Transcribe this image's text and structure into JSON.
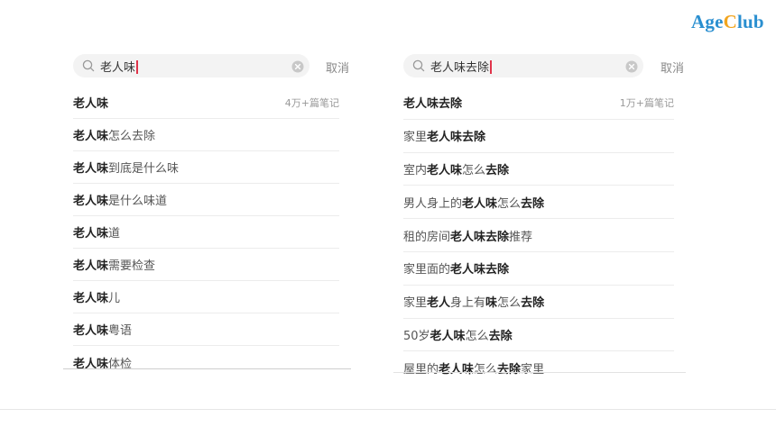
{
  "logo": {
    "part1": "Age",
    "part2": "C",
    "part3": "lub"
  },
  "left": {
    "query": "老人味",
    "cancel": "取消",
    "suggestions": [
      {
        "segments": [
          {
            "t": "老人味",
            "b": true
          }
        ],
        "count": "4万+篇笔记"
      },
      {
        "segments": [
          {
            "t": "老人味",
            "b": true
          },
          {
            "t": "怎么去除",
            "b": false
          }
        ]
      },
      {
        "segments": [
          {
            "t": "老人味",
            "b": true
          },
          {
            "t": "到底是什么味",
            "b": false
          }
        ]
      },
      {
        "segments": [
          {
            "t": "老人味",
            "b": true
          },
          {
            "t": "是什么味道",
            "b": false
          }
        ]
      },
      {
        "segments": [
          {
            "t": "老人味",
            "b": true
          },
          {
            "t": "道",
            "b": false
          }
        ]
      },
      {
        "segments": [
          {
            "t": "老人味",
            "b": true
          },
          {
            "t": "需要检查",
            "b": false
          }
        ]
      },
      {
        "segments": [
          {
            "t": "老人味",
            "b": true
          },
          {
            "t": "儿",
            "b": false
          }
        ]
      },
      {
        "segments": [
          {
            "t": "老人味",
            "b": true
          },
          {
            "t": "粤语",
            "b": false
          }
        ]
      },
      {
        "segments": [
          {
            "t": "老人味",
            "b": true
          },
          {
            "t": "体检",
            "b": false
          }
        ]
      }
    ]
  },
  "right": {
    "query": "老人味去除",
    "cancel": "取消",
    "suggestions": [
      {
        "segments": [
          {
            "t": "老人味去除",
            "b": true
          }
        ],
        "count": "1万+篇笔记"
      },
      {
        "segments": [
          {
            "t": "家里",
            "b": false
          },
          {
            "t": "老人味去除",
            "b": true
          }
        ]
      },
      {
        "segments": [
          {
            "t": "室内",
            "b": false
          },
          {
            "t": "老人味",
            "b": true
          },
          {
            "t": "怎么",
            "b": false
          },
          {
            "t": "去除",
            "b": true
          }
        ]
      },
      {
        "segments": [
          {
            "t": "男人身上的",
            "b": false
          },
          {
            "t": "老人味",
            "b": true
          },
          {
            "t": "怎么",
            "b": false
          },
          {
            "t": "去除",
            "b": true
          }
        ]
      },
      {
        "segments": [
          {
            "t": "租的房间",
            "b": false
          },
          {
            "t": "老人味去除",
            "b": true
          },
          {
            "t": "推荐",
            "b": false
          }
        ]
      },
      {
        "segments": [
          {
            "t": "家里面的",
            "b": false
          },
          {
            "t": "老人味去除",
            "b": true
          }
        ]
      },
      {
        "segments": [
          {
            "t": "家里",
            "b": false
          },
          {
            "t": "老人",
            "b": true
          },
          {
            "t": "身上有",
            "b": false
          },
          {
            "t": "味",
            "b": true
          },
          {
            "t": "怎么",
            "b": false
          },
          {
            "t": "去除",
            "b": true
          }
        ]
      },
      {
        "segments": [
          {
            "t": "50岁",
            "b": false
          },
          {
            "t": "老人味",
            "b": true
          },
          {
            "t": "怎么",
            "b": false
          },
          {
            "t": "去除",
            "b": true
          }
        ]
      },
      {
        "segments": [
          {
            "t": "屋里的",
            "b": false
          },
          {
            "t": "老人味",
            "b": true
          },
          {
            "t": "怎么",
            "b": false
          },
          {
            "t": "去除",
            "b": true
          },
          {
            "t": "家里",
            "b": false
          }
        ]
      }
    ]
  },
  "icons": {
    "search": "search-icon",
    "clear": "clear-icon"
  },
  "colors": {
    "caret": "#e0344a",
    "logo_blue": "#2a8fd0",
    "logo_orange": "#f2a51f"
  }
}
